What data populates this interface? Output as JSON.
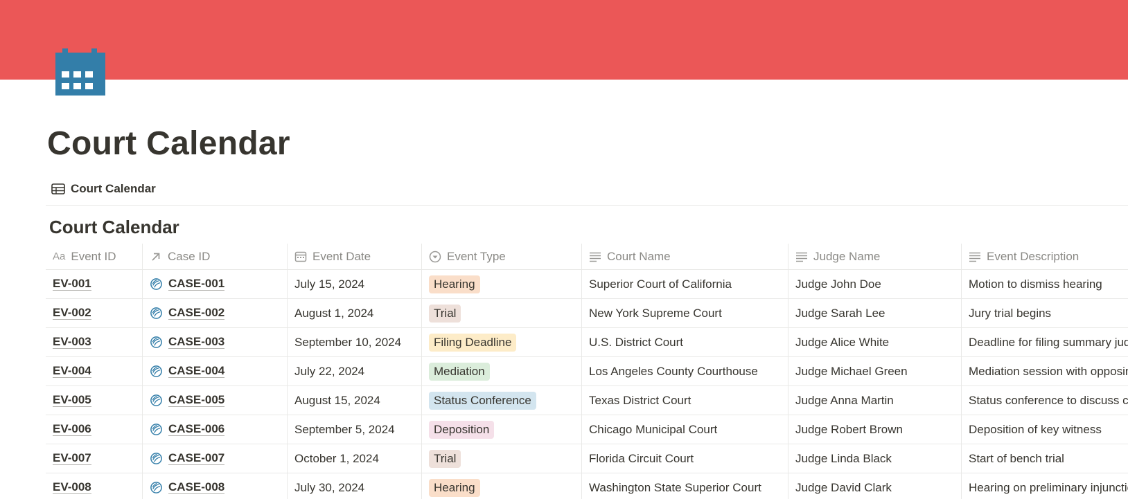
{
  "cover": {
    "color": "#eb5757"
  },
  "page": {
    "icon": "calendar-icon",
    "icon_color": "#337ea9",
    "title": "Court Calendar"
  },
  "view_tab": {
    "icon": "table-icon",
    "label": "Court Calendar"
  },
  "database": {
    "title": "Court Calendar",
    "columns": [
      {
        "label": "Event ID",
        "icon": "Aa"
      },
      {
        "label": "Case ID",
        "icon": "relation-arrow-icon"
      },
      {
        "label": "Event Date",
        "icon": "calendar-small-icon"
      },
      {
        "label": "Event Type",
        "icon": "select-icon"
      },
      {
        "label": "Court Name",
        "icon": "text-lines-icon"
      },
      {
        "label": "Judge Name",
        "icon": "text-lines-icon"
      },
      {
        "label": "Event Description",
        "icon": "text-lines-icon"
      }
    ],
    "rows": [
      {
        "event_id": "EV-001",
        "case_id": "CASE-001",
        "date": "July 15, 2024",
        "type": "Hearing",
        "type_color": "#fadec9",
        "court": "Superior Court of California",
        "judge": "Judge John Doe",
        "description": "Motion to dismiss hearing"
      },
      {
        "event_id": "EV-002",
        "case_id": "CASE-002",
        "date": "August 1, 2024",
        "type": "Trial",
        "type_color": "#eee0da",
        "court": "New York Supreme Court",
        "judge": "Judge Sarah Lee",
        "description": "Jury trial begins"
      },
      {
        "event_id": "EV-003",
        "case_id": "CASE-003",
        "date": "September 10, 2024",
        "type": "Filing Deadline",
        "type_color": "#fdecc8",
        "court": "U.S. District Court",
        "judge": "Judge Alice White",
        "description": "Deadline for filing summary judgment motion"
      },
      {
        "event_id": "EV-004",
        "case_id": "CASE-004",
        "date": "July 22, 2024",
        "type": "Mediation",
        "type_color": "#dbeddb",
        "court": "Los Angeles County Courthouse",
        "judge": "Judge Michael Green",
        "description": "Mediation session with opposing counsel"
      },
      {
        "event_id": "EV-005",
        "case_id": "CASE-005",
        "date": "August 15, 2024",
        "type": "Status Conference",
        "type_color": "#d3e5ef",
        "court": "Texas District Court",
        "judge": "Judge Anna Martin",
        "description": "Status conference to discuss case progress"
      },
      {
        "event_id": "EV-006",
        "case_id": "CASE-006",
        "date": "September 5, 2024",
        "type": "Deposition",
        "type_color": "#f5e0e9",
        "court": "Chicago Municipal Court",
        "judge": "Judge Robert Brown",
        "description": "Deposition of key witness"
      },
      {
        "event_id": "EV-007",
        "case_id": "CASE-007",
        "date": "October 1, 2024",
        "type": "Trial",
        "type_color": "#eee0da",
        "court": "Florida Circuit Court",
        "judge": "Judge Linda Black",
        "description": "Start of bench trial"
      },
      {
        "event_id": "EV-008",
        "case_id": "CASE-008",
        "date": "July 30, 2024",
        "type": "Hearing",
        "type_color": "#fadec9",
        "court": "Washington State Superior Court",
        "judge": "Judge David Clark",
        "description": "Hearing on preliminary injunction"
      }
    ]
  }
}
